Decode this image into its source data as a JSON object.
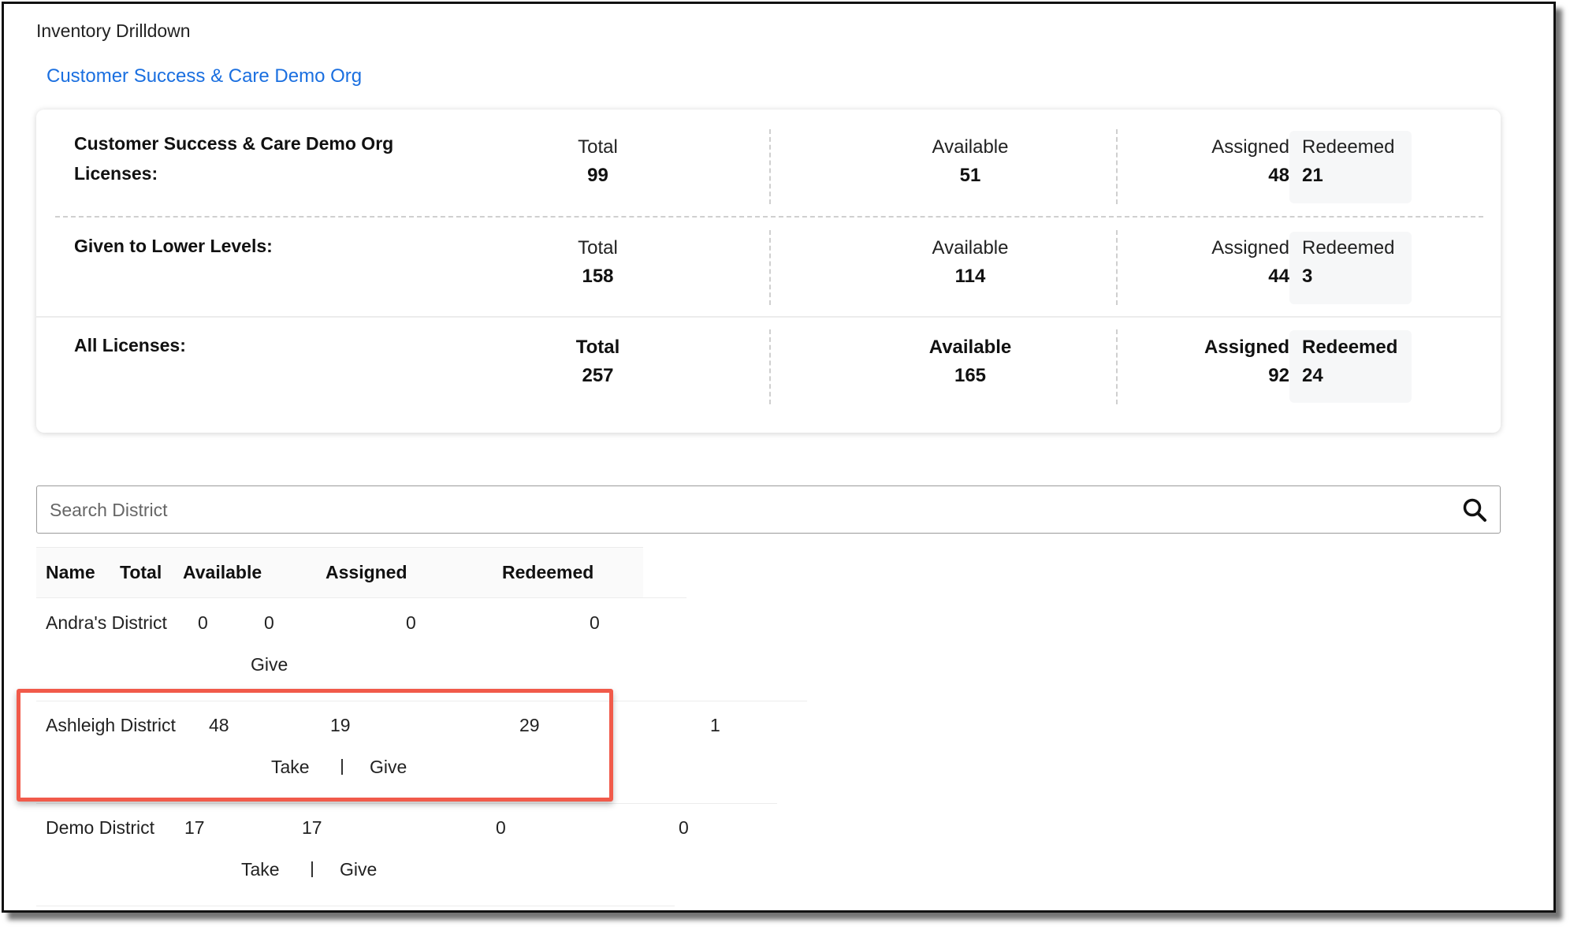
{
  "page": {
    "title": "Inventory Drilldown",
    "org_link": "Customer Success & Care Demo Org"
  },
  "summary": {
    "rows": [
      {
        "label_line1": "Customer Success & Care Demo Org",
        "label_line2": "Licenses:",
        "total_label": "Total",
        "total": "99",
        "available_label": "Available",
        "available": "51",
        "assigned_label": "Assigned",
        "assigned": "48",
        "redeemed_label": "Redeemed",
        "redeemed": "21"
      },
      {
        "label_line1": "Given to Lower Levels:",
        "total_label": "Total",
        "total": "158",
        "available_label": "Available",
        "available": "114",
        "assigned_label": "Assigned",
        "assigned": "44",
        "redeemed_label": "Redeemed",
        "redeemed": "3"
      },
      {
        "label_line1": "All Licenses:",
        "total_label": "Total",
        "total": "257",
        "available_label": "Available",
        "available": "165",
        "assigned_label": "Assigned",
        "assigned": "92",
        "redeemed_label": "Redeemed",
        "redeemed": "24"
      }
    ]
  },
  "search": {
    "placeholder": "Search District",
    "icon": "search-icon"
  },
  "table": {
    "headers": [
      "Name",
      "Total",
      "Available",
      "Assigned",
      "Redeemed"
    ],
    "rows": [
      {
        "name": "Andra's District",
        "total": "0",
        "available": "0",
        "assigned": "0",
        "redeemed": "0",
        "actions": [
          "Give"
        ]
      },
      {
        "name": "Ashleigh District",
        "total": "48",
        "available": "19",
        "assigned": "29",
        "redeemed": "1",
        "actions": [
          "Take",
          "Give"
        ]
      },
      {
        "name": "Demo District",
        "total": "17",
        "available": "17",
        "assigned": "0",
        "redeemed": "0",
        "actions": [
          "Take",
          "Give"
        ]
      }
    ]
  },
  "colors": {
    "link": "#1a6fe0",
    "highlight_border": "#f15a4a",
    "redeemed_bg": "#f6f7f8"
  }
}
